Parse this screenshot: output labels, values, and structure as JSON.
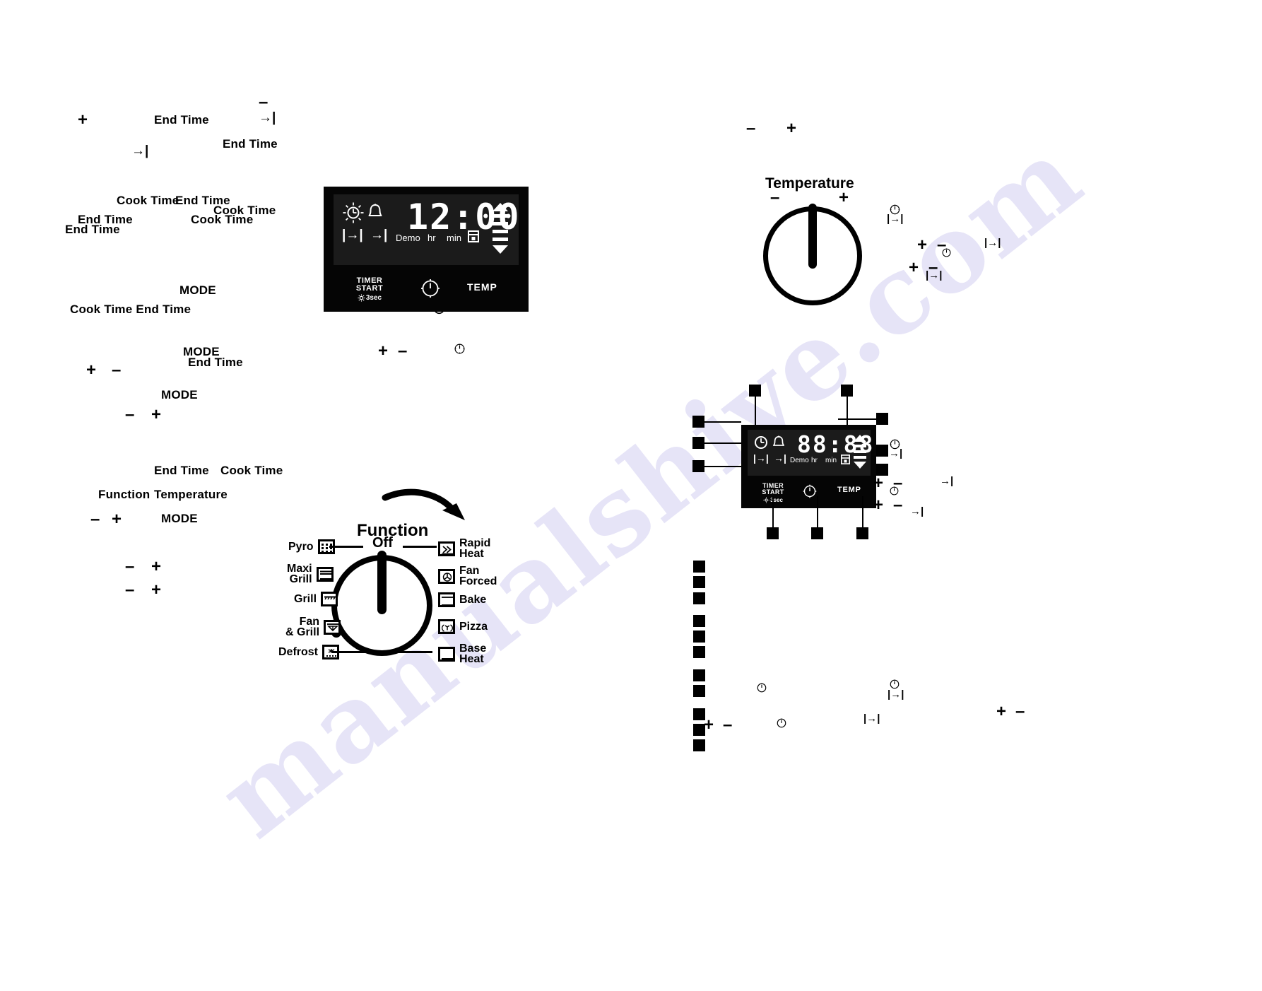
{
  "page": {
    "watermark": "manualshive.com",
    "background": "#ffffff",
    "ink": "#000000",
    "panel_bg": "#050505",
    "lcd_bg": "#1b1b1b",
    "lcd_fg": "#ffffff",
    "watermark_color": "#807ad6"
  },
  "scattered_left": [
    {
      "text": "+",
      "kind": "symbol"
    },
    {
      "text": "End Time",
      "kind": "label"
    },
    {
      "text": "–",
      "kind": "symbol"
    },
    {
      "text": "→|",
      "kind": "symbol"
    },
    {
      "text": "End Time",
      "kind": "label"
    },
    {
      "text": "→|",
      "kind": "symbol"
    },
    {
      "text": "Cook Time",
      "kind": "label"
    },
    {
      "text": "End Time",
      "kind": "label"
    },
    {
      "text": "Cook Time",
      "kind": "label"
    },
    {
      "text": "End Time",
      "kind": "label"
    },
    {
      "text": "Cook Time",
      "kind": "label"
    },
    {
      "text": "End Time",
      "kind": "label"
    },
    {
      "text": "MODE",
      "kind": "label"
    },
    {
      "text": "Cook Time End Time",
      "kind": "label"
    },
    {
      "text": "MODE",
      "kind": "label"
    },
    {
      "text": "End Time",
      "kind": "label"
    },
    {
      "text": "+",
      "kind": "symbol"
    },
    {
      "text": "–",
      "kind": "symbol"
    },
    {
      "text": "MODE",
      "kind": "label"
    },
    {
      "text": "–",
      "kind": "symbol"
    },
    {
      "text": "+",
      "kind": "symbol"
    },
    {
      "text": "End Time",
      "kind": "label"
    },
    {
      "text": "Cook Time",
      "kind": "label"
    },
    {
      "text": "Function",
      "kind": "label"
    },
    {
      "text": "Temperature",
      "kind": "label"
    },
    {
      "text": "–",
      "kind": "symbol"
    },
    {
      "text": "+",
      "kind": "symbol"
    },
    {
      "text": "MODE",
      "kind": "label"
    },
    {
      "text": "–",
      "kind": "symbol"
    },
    {
      "text": "+",
      "kind": "symbol"
    },
    {
      "text": "–",
      "kind": "symbol"
    },
    {
      "text": "+",
      "kind": "symbol"
    }
  ],
  "panel_one": {
    "lcd": {
      "display_value": "12:00",
      "unit_hr": "hr",
      "unit_min": "min",
      "demo": "Demo",
      "icons": [
        "time-of-day-sun-clock-icon",
        "bell-timer-icon",
        "cook-time-icon",
        "end-time-icon",
        "oven-lock-icon",
        "temperature-up-arrow-icon",
        "temperature-down-arrow-icon"
      ]
    },
    "buttons": [
      {
        "label_line1": "TIMER",
        "label_line2": "START",
        "label_line3": "3sec",
        "name": "timer-start-button"
      },
      {
        "label_line1": "",
        "label_line2": "",
        "label_line3": "",
        "name": "clock-button"
      },
      {
        "label_line1": "TEMP",
        "label_line2": "",
        "label_line3": "",
        "name": "temp-button"
      }
    ]
  },
  "panel_two": {
    "lcd": {
      "display_value": "88:88",
      "unit_hr": "hr",
      "unit_min": "min",
      "demo": "Demo"
    },
    "buttons": [
      {
        "label_line1": "TIMER",
        "label_line2": "START",
        "label_line3": "3sec"
      },
      {
        "label_line1": "",
        "label_line2": "",
        "label_line3": ""
      },
      {
        "label_line1": "TEMP",
        "label_line2": "",
        "label_line3": ""
      }
    ],
    "callout_count_top": 2,
    "callout_count_right": 3,
    "callout_count_left": 3,
    "callout_count_bottom": 3,
    "marker_column_count": 11
  },
  "temperature_dial": {
    "title": "Temperature",
    "minus": "–",
    "plus": "+"
  },
  "function_dial": {
    "title": "Function",
    "off_label": "Off",
    "left_options": [
      {
        "label": "Pyro",
        "icon": "pyro-icon"
      },
      {
        "label": "Maxi\nGrill",
        "icon": "maxi-grill-icon"
      },
      {
        "label": "Grill",
        "icon": "grill-icon"
      },
      {
        "label": "Fan\n& Grill",
        "icon": "fan-and-grill-icon"
      },
      {
        "label": "Defrost",
        "icon": "defrost-icon"
      }
    ],
    "right_options": [
      {
        "label": "Rapid\nHeat",
        "icon": "rapid-heat-icon"
      },
      {
        "label": "Fan\nForced",
        "icon": "fan-forced-icon"
      },
      {
        "label": "Bake",
        "icon": "bake-icon"
      },
      {
        "label": "Pizza",
        "icon": "pizza-icon"
      },
      {
        "label": "Base\nHeat",
        "icon": "base-heat-icon"
      }
    ]
  },
  "scattered_right": [
    {
      "text": "–",
      "kind": "symbol"
    },
    {
      "text": "+",
      "kind": "symbol"
    },
    {
      "text": "+",
      "kind": "symbol"
    },
    {
      "text": "–",
      "kind": "symbol"
    },
    {
      "text": "|→|",
      "kind": "symbol"
    },
    {
      "text": "+",
      "kind": "symbol"
    },
    {
      "text": "–",
      "kind": "symbol"
    },
    {
      "text": "|→|",
      "kind": "symbol"
    },
    {
      "text": "+",
      "kind": "symbol"
    },
    {
      "text": "–",
      "kind": "symbol"
    },
    {
      "text": "→|",
      "kind": "symbol"
    },
    {
      "text": "+",
      "kind": "symbol"
    },
    {
      "text": "–",
      "kind": "symbol"
    },
    {
      "text": "→|",
      "kind": "symbol"
    },
    {
      "text": "+",
      "kind": "symbol"
    },
    {
      "text": "–",
      "kind": "symbol"
    },
    {
      "text": "|→|",
      "kind": "symbol"
    },
    {
      "text": "+",
      "kind": "symbol"
    },
    {
      "text": "–",
      "kind": "symbol"
    }
  ]
}
